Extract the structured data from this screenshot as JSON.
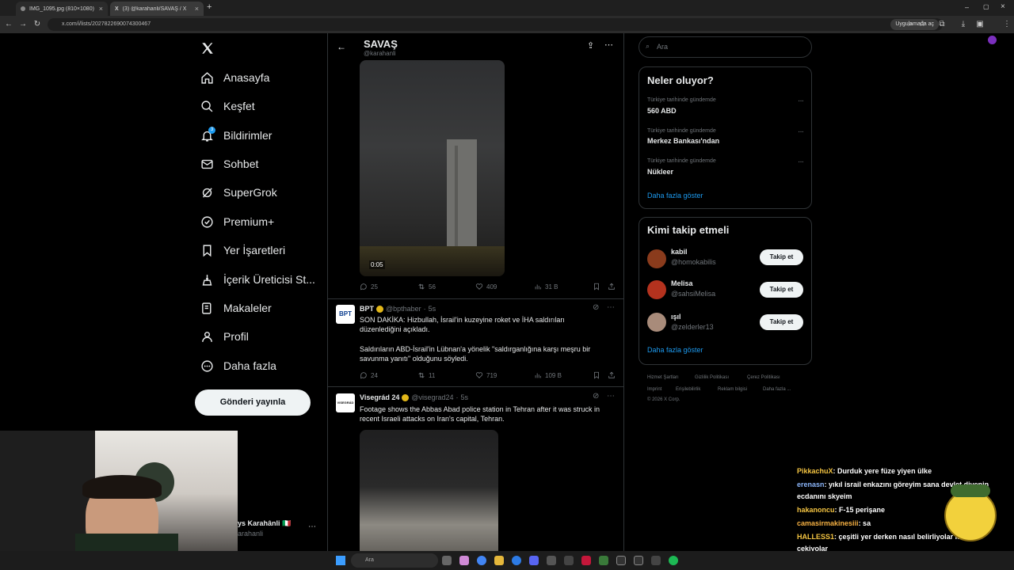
{
  "browser": {
    "tabs": [
      {
        "title": "IMG_1095.jpg (810×1080)"
      },
      {
        "title": "(3) @karahanli/SAVAŞ / X"
      }
    ],
    "url": "x.com/i/lists/2027822690074300467",
    "open_in_app": "Uygulamada aç"
  },
  "nav": {
    "items": [
      {
        "label": "Anasayfa",
        "icon": "home-icon"
      },
      {
        "label": "Keşfet",
        "icon": "search-icon"
      },
      {
        "label": "Bildirimler",
        "icon": "bell-icon",
        "badge": "3"
      },
      {
        "label": "Sohbet",
        "icon": "mail-icon"
      },
      {
        "label": "SuperGrok",
        "icon": "grok-icon"
      },
      {
        "label": "Premium+",
        "icon": "verified-icon"
      },
      {
        "label": "Yer İşaretleri",
        "icon": "bookmark-icon"
      },
      {
        "label": "İçerik Üreticisi St...",
        "icon": "creator-icon"
      },
      {
        "label": "Makaleler",
        "icon": "articles-icon"
      },
      {
        "label": "Profil",
        "icon": "person-icon"
      },
      {
        "label": "Daha fazla",
        "icon": "more-circle-icon"
      }
    ],
    "post_button": "Gönderi yayınla"
  },
  "profile": {
    "name": "ys Karahânli 🇮🇹",
    "handle": "arahanli"
  },
  "list": {
    "title": "SAVAŞ",
    "handle": "@karahanli"
  },
  "tweets": [
    {
      "video_time": "0:05",
      "replies": "25",
      "reposts": "56",
      "likes": "409",
      "views": "31 B"
    },
    {
      "name": "BPT",
      "handle": "@bpthaber",
      "time": "5s",
      "avatar_text": "BPT",
      "text1": "SON DAKİKA: Hizbullah, İsrail'in kuzeyine roket ve İHA saldırıları düzenlediğini açıkladı.",
      "text2": "Saldırıların ABD-İsrail'in Lübnan'a yönelik \"saldırganlığına karşı meşru bir savunma yanıtı\" olduğunu söyledi.",
      "replies": "24",
      "reposts": "11",
      "likes": "719",
      "views": "109 B"
    },
    {
      "name": "Visegrád 24",
      "handle": "@visegrad24",
      "time": "5s",
      "avatar_text": "VISEGRÁD",
      "text1": "Footage shows the Abbas Abad police station in Tehran after it was struck in recent Israeli attacks on Iran's capital, Tehran."
    }
  ],
  "right": {
    "search_placeholder": "Ara",
    "trends_title": "Neler oluyor?",
    "trends": [
      {
        "context": "Türkiye tarihinde gündemde",
        "name": "560 ABD"
      },
      {
        "context": "Türkiye tarihinde gündemde",
        "name": "Merkez Bankası'ndan"
      },
      {
        "context": "Türkiye tarihinde gündemde",
        "name": "Nükleer"
      }
    ],
    "show_more": "Daha fazla göster",
    "follow_title": "Kimi takip etmeli",
    "follow": [
      {
        "name": "kabil",
        "handle": "@homokabilis",
        "button": "Takip et",
        "color": "#8a3b1c"
      },
      {
        "name": "Melisa",
        "handle": "@sahsiMelisa",
        "button": "Takip et",
        "color": "#b4321e"
      },
      {
        "name": "ışıl",
        "handle": "@zelderler13",
        "button": "Takip et",
        "color": "#a88b7a"
      }
    ],
    "footer": [
      "Hizmet Şartları",
      "Gizlilik Politikası",
      "Çerez Politikası",
      "Imprint",
      "Erişilebilirlik",
      "Reklam bilgisi",
      "Daha fazla ...",
      "© 2026 X Corp."
    ]
  },
  "chat": [
    {
      "user": "PikkachuX",
      "message": ": Durduk yere füze yiyen ülke",
      "color": "#f5c542"
    },
    {
      "user": "erenasn",
      "message": ": yıkıl israil enkazını göreyim sana devlet diyenin",
      "color": "#8ab4f8"
    },
    {
      "user": "",
      "message": "ecdanını skyeim",
      "color": "#ffffff"
    },
    {
      "user": "hakanoncu",
      "message": ": F-15 perişane",
      "color": "#f5c542"
    },
    {
      "user": "camasirmakinesiii",
      "message": ": sa",
      "color": "#f5b042"
    },
    {
      "user": "HALLESS1",
      "message": ": çeşitli yer derken nasıl belirliyolar kura mı",
      "color": "#f5c542"
    },
    {
      "user": "",
      "message": "çekiyolar",
      "color": "#ffffff"
    }
  ],
  "taskbar": {
    "search": "Ara"
  },
  "colors": {
    "accent": "#1d9bf0",
    "background": "#000000",
    "border": "#2f3336",
    "muted": "#71767b"
  }
}
